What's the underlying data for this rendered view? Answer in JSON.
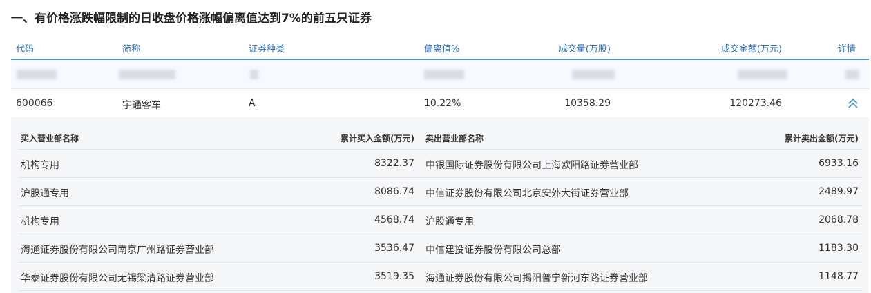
{
  "title": "一、有价格涨跌幅限制的日收盘价格涨幅偏离值达到7%的前五只证券",
  "columns": {
    "code": "代码",
    "name": "简称",
    "type": "证券种类",
    "deviation": "偏离值%",
    "volume": "成交量(万股)",
    "amount": "成交金额(万元)",
    "detail": "详情"
  },
  "stock": {
    "code": "600066",
    "name": "宇通客车",
    "type": "A",
    "deviation": "10.22%",
    "volume": "10358.29",
    "amount": "120273.46",
    "detail_icon": "chevron-up-double-icon"
  },
  "sub_columns": {
    "buy_name": "买入营业部名称",
    "buy_amount": "累计买入金额(万元)",
    "sell_name": "卖出营业部名称",
    "sell_amount": "累计卖出金额(万元)"
  },
  "sub_rows": [
    {
      "buy_name": "机构专用",
      "buy_amount": "8322.37",
      "sell_name": "中银国际证券股份有限公司上海欧阳路证券营业部",
      "sell_amount": "6933.16"
    },
    {
      "buy_name": "沪股通专用",
      "buy_amount": "8086.74",
      "sell_name": "中信证券股份有限公司北京安外大街证券营业部",
      "sell_amount": "2489.97"
    },
    {
      "buy_name": "机构专用",
      "buy_amount": "4568.74",
      "sell_name": "沪股通专用",
      "sell_amount": "2068.78"
    },
    {
      "buy_name": "海通证券股份有限公司南京广州路证券营业部",
      "buy_amount": "3536.47",
      "sell_name": "中信建投证券股份有限公司总部",
      "sell_amount": "1183.30"
    },
    {
      "buy_name": "华泰证券股份有限公司无锡梁清路证券营业部",
      "buy_amount": "3519.35",
      "sell_name": "海通证券股份有限公司揭阳普宁新河东路证券营业部",
      "sell_amount": "1148.77"
    }
  ],
  "colors": {
    "header_text": "#2f6fb5",
    "header_border": "#3d8fd8",
    "panel_bg": "#f5f6f8"
  }
}
